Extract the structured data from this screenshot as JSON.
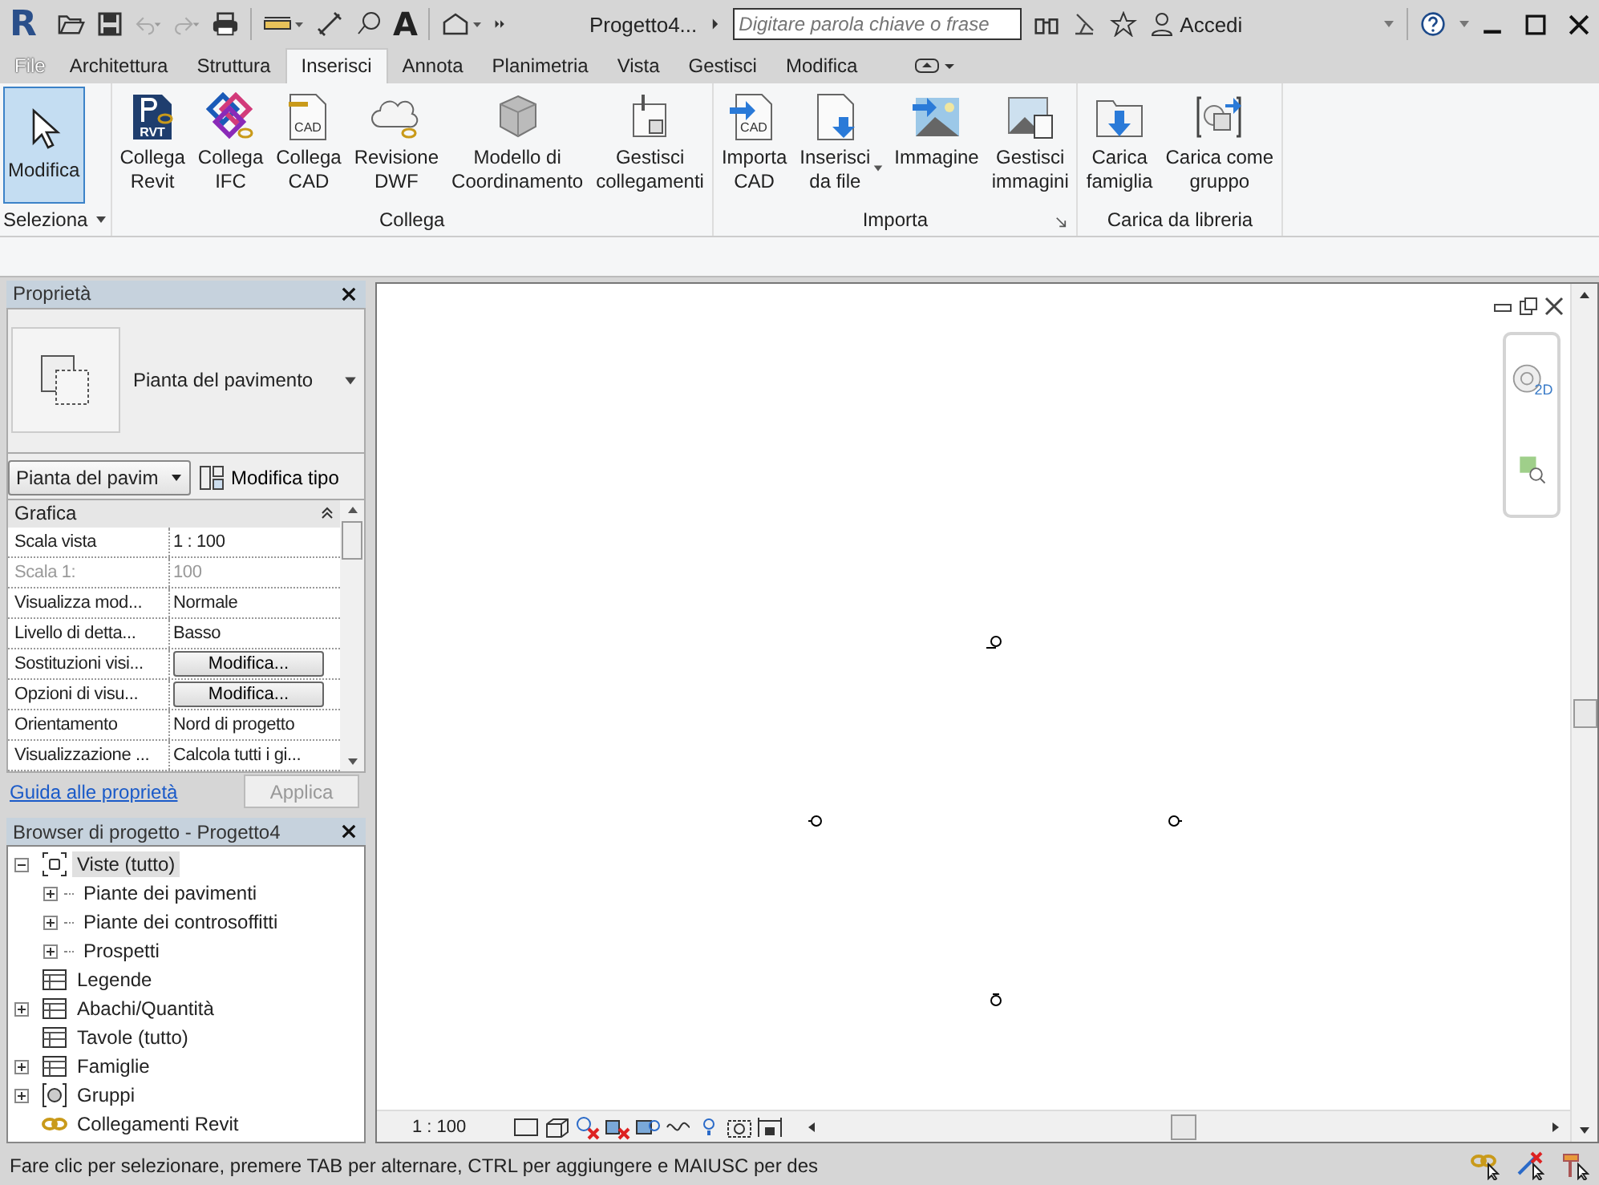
{
  "app": {
    "logo": "R",
    "text_tool": "A",
    "title": "Progetto4...",
    "search": {
      "placeholder": "Digitare parola chiave o frase"
    },
    "user": "Accedi"
  },
  "tabs": [
    {
      "label": "File",
      "kind": "file",
      "selected": false
    },
    {
      "label": "Architettura",
      "kind": "tab",
      "selected": false
    },
    {
      "label": "Struttura",
      "kind": "tab",
      "selected": false
    },
    {
      "label": "Inserisci",
      "kind": "tab",
      "selected": true
    },
    {
      "label": "Annota",
      "kind": "tab",
      "selected": false
    },
    {
      "label": "Planimetria",
      "kind": "tab",
      "selected": false
    },
    {
      "label": "Vista",
      "kind": "tab",
      "selected": false
    },
    {
      "label": "Gestisci",
      "kind": "tab",
      "selected": false
    },
    {
      "label": "Modifica",
      "kind": "tab",
      "selected": false
    }
  ],
  "ribbon": [
    {
      "title": "Seleziona",
      "menu": true,
      "buttons": [
        {
          "lines": [
            "Modifica"
          ],
          "selected": true
        }
      ]
    },
    {
      "title": "Collega",
      "buttons": [
        {
          "lines": [
            "Collega",
            "Revit"
          ],
          "badge": "RVT",
          "selected": false
        },
        {
          "lines": [
            "Collega",
            "IFC"
          ],
          "selected": false
        },
        {
          "lines": [
            "Collega",
            "CAD"
          ],
          "badge": "CAD",
          "selected": false
        },
        {
          "lines": [
            "Revisione",
            "DWF"
          ],
          "selected": false
        },
        {
          "lines": [
            "Modello di",
            "Coordinamento"
          ],
          "selected": false
        },
        {
          "lines": [
            "Gestisci",
            "collegamenti"
          ],
          "selected": false
        }
      ]
    },
    {
      "title": "Importa",
      "launcher": true,
      "buttons": [
        {
          "lines": [
            "Importa",
            "CAD"
          ],
          "badge": "CAD",
          "selected": false
        },
        {
          "lines": [
            "Inserisci",
            "da file"
          ],
          "selected": false,
          "dropdown": true
        },
        {
          "lines": [
            "Immagine"
          ],
          "selected": false
        },
        {
          "lines": [
            "Gestisci",
            "immagini"
          ],
          "selected": false
        }
      ]
    },
    {
      "title": "Carica da libreria",
      "buttons": [
        {
          "lines": [
            "Carica",
            "famiglia"
          ],
          "selected": false
        },
        {
          "lines": [
            "Carica come",
            "gruppo"
          ],
          "selected": false
        }
      ]
    }
  ],
  "properties": {
    "title": "Proprietà",
    "type": "Pianta del pavimento",
    "instance": "Pianta del pavim",
    "edit_type": "Modifica tipo",
    "group": "Grafica",
    "rows": [
      {
        "name": "Scala vista",
        "value": "1 : 100",
        "kind": "text",
        "disabled": false
      },
      {
        "name": "Scala  1:",
        "value": "100",
        "kind": "text",
        "disabled": true
      },
      {
        "name": "Visualizza mod...",
        "value": "Normale",
        "kind": "text",
        "disabled": false
      },
      {
        "name": "Livello di detta...",
        "value": "Basso",
        "kind": "text",
        "disabled": false
      },
      {
        "name": "Sostituzioni visi...",
        "value": "Modifica...",
        "kind": "button",
        "disabled": false
      },
      {
        "name": "Opzioni di visu...",
        "value": "Modifica...",
        "kind": "button",
        "disabled": false
      },
      {
        "name": "Orientamento",
        "value": "Nord di progetto",
        "kind": "text",
        "disabled": false
      },
      {
        "name": "Visualizzazione ...",
        "value": "Calcola tutti i gi...",
        "kind": "text",
        "disabled": false
      }
    ],
    "help": "Guida alle proprietà",
    "apply": {
      "label": "Applica",
      "disabled": true
    }
  },
  "browser": {
    "title": "Browser di progetto - Progetto4",
    "tree": [
      {
        "label": "Viste (tutto)",
        "expanded": true,
        "selected": true,
        "children": [
          {
            "label": "Piante dei pavimenti",
            "expanded": false,
            "selected": false
          },
          {
            "label": "Piante dei controsoffitti",
            "expanded": false,
            "selected": false
          },
          {
            "label": "Prospetti",
            "expanded": false,
            "selected": false
          }
        ]
      },
      {
        "label": "Legende",
        "selected": false
      },
      {
        "label": "Abachi/Quantità",
        "expanded": false,
        "selected": false
      },
      {
        "label": "Tavole (tutto)",
        "selected": false
      },
      {
        "label": "Famiglie",
        "expanded": false,
        "selected": false
      },
      {
        "label": "Gruppi",
        "expanded": false,
        "selected": false
      },
      {
        "label": "Collegamenti Revit",
        "selected": false
      }
    ]
  },
  "view": {
    "scale": "1 : 100",
    "nav_badge": "2D"
  },
  "status_bar": {
    "text": "Fare clic per selezionare, premere TAB per alternare, CTRL per aggiungere e MAIUSC per des"
  }
}
